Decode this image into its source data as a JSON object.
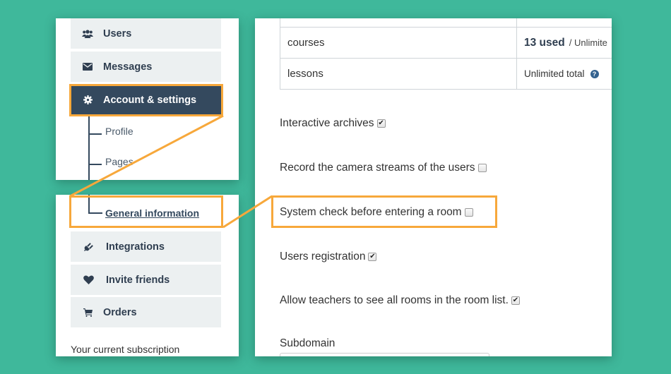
{
  "sidebar": {
    "top_items": [
      {
        "label": "Users",
        "icon": "users-icon"
      },
      {
        "label": "Messages",
        "icon": "envelope-icon"
      },
      {
        "label": "Account & settings",
        "icon": "gear-icon",
        "active": true
      }
    ],
    "sub_items": [
      {
        "label": "Profile"
      },
      {
        "label": "Pages"
      },
      {
        "label": "General information",
        "current": true
      }
    ],
    "bottom_items": [
      {
        "label": "Integrations",
        "icon": "plug-icon"
      },
      {
        "label": "Invite friends",
        "icon": "heart-icon"
      },
      {
        "label": "Orders",
        "icon": "cart-icon"
      }
    ],
    "subscription_caption": "Your current subscription"
  },
  "usage_table": {
    "rows": [
      {
        "name": "courses",
        "used": "13 used",
        "limit": "/ Unlimite"
      },
      {
        "name": "lessons",
        "limit": "Unlimited total",
        "help_icon": "question-circle-icon"
      }
    ]
  },
  "settings": {
    "options": [
      {
        "label": "Interactive archives",
        "checked": true
      },
      {
        "label": "Record the camera streams of the users",
        "checked": false
      },
      {
        "label": "System check before entering a room",
        "checked": false,
        "highlighted": true
      },
      {
        "label": "Users registration",
        "checked": true
      },
      {
        "label": "Allow teachers to see all rooms in the room list.",
        "checked": true
      }
    ],
    "subdomain_label": "Subdomain",
    "subdomain_value": ""
  },
  "colors": {
    "background": "#3fb89b",
    "highlight": "#f7a83b",
    "nav_active": "#34495e",
    "nav_item": "#ecf0f1"
  }
}
